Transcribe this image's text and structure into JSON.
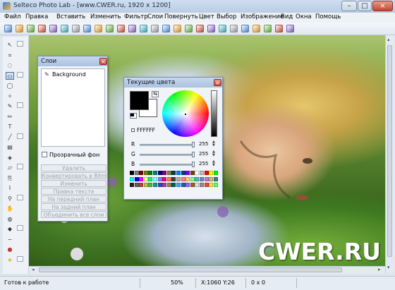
{
  "window": {
    "title": "Selteco Photo Lab - [www.CWER.ru, 1920 x 1200]",
    "controls": [
      "–",
      "□",
      "×"
    ]
  },
  "menu": [
    "Файл",
    "Правка",
    "Вставить",
    "Изменить",
    "Фильтр",
    "Слои",
    "Повернуть",
    "Цвет",
    "Выбор",
    "Изображение",
    "Вид",
    "Окна",
    "Помощь"
  ],
  "toolbar_icons": [
    "new-icon",
    "open-icon",
    "print-icon",
    "folder-icon",
    "save-icon",
    "scan-icon",
    "export-icon",
    "copy-icon",
    "cut-icon",
    "paste-icon",
    "undo-icon",
    "redo-icon",
    "crop-icon",
    "resize-icon",
    "rotate-icon",
    "flip-icon",
    "text-icon",
    "arrows-icon",
    "brightness-icon",
    "contrast-icon",
    "levels-icon",
    "color-icon",
    "zoom-icon",
    "zoom-out-icon",
    "fit-icon",
    "actual-size-icon"
  ],
  "tools": [
    "arrow-tool",
    "crop-tool",
    "lasso-tool",
    "rect-select-tool",
    "ellipse-select-tool",
    "magic-wand-tool",
    "brush-tool",
    "pencil-tool",
    "text-tool",
    "line-tool",
    "gradient-tool",
    "fill-tool",
    "eraser-tool",
    "clone-tool",
    "eyedropper-tool",
    "zoom-tool",
    "hand-tool",
    "blur-tool",
    "sharpen-tool",
    "smudge-tool",
    "redeye-tool",
    "star-tool"
  ],
  "layers_panel": {
    "title": "Слои",
    "layers": [
      "Background"
    ],
    "transparent_bg_label": "Прозрачный фон",
    "buttons": [
      "Удалить",
      "Конвертировать в Bitmap",
      "Изменить",
      "Правка текста",
      "На передний план",
      "На задний план",
      "Объединить все слои"
    ]
  },
  "colors_panel": {
    "title": "Текущие цвета",
    "foreground": "#000000",
    "background": "#FFFFFF",
    "hex_value": "FFFFFF",
    "channels": [
      {
        "label": "R",
        "value": "255",
        "level": 1.0
      },
      {
        "label": "G",
        "value": "255",
        "level": 1.0
      },
      {
        "label": "B",
        "value": "255",
        "level": 1.0
      }
    ],
    "swatches": [
      "#000000",
      "#808080",
      "#800000",
      "#808000",
      "#008000",
      "#008080",
      "#000080",
      "#800080",
      "#808040",
      "#004040",
      "#0080ff",
      "#004080",
      "#8000ff",
      "#804000",
      "#ffffff",
      "#c0c0c0",
      "#ff0000",
      "#ffff00",
      "#00ff00",
      "#00ffff",
      "#0000ff",
      "#ff00ff",
      "#ffff80",
      "#00ff80",
      "#80ffff",
      "#8080ff",
      "#ff0080",
      "#ff8040",
      "#404040",
      "#b0b0b0",
      "#ff8080",
      "#ffcc80",
      "#80ff80",
      "#40c0c0",
      "#8080c0",
      "#c080c0",
      "#c0c080",
      "#408080",
      "#202020",
      "#606060",
      "#c04040",
      "#c0c040",
      "#40c040",
      "#2090a0",
      "#4040c0",
      "#a040a0",
      "#a08040",
      "#006060",
      "#40a0ff",
      "#2060a0",
      "#a060ff",
      "#a06020",
      "#e0e0e0",
      "#909090",
      "#ff4040",
      "#ffe040",
      "#60ff60"
    ]
  },
  "status": {
    "message": "Готов к работе",
    "zoom": "50%",
    "coords": "X:1060  Y:26",
    "selection": "0 x 0"
  },
  "watermark": "CWER.RU"
}
